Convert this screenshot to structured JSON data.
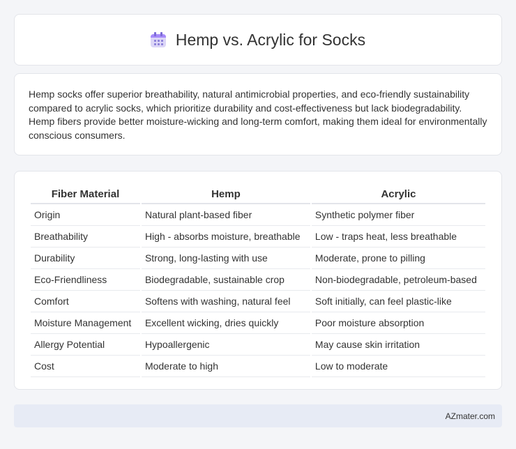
{
  "header": {
    "title": "Hemp vs. Acrylic for Socks",
    "icon": "calendar-icon"
  },
  "summary": "Hemp socks offer superior breathability, natural antimicrobial properties, and eco-friendly sustainability compared to acrylic socks, which prioritize durability and cost-effectiveness but lack biodegradability. Hemp fibers provide better moisture-wicking and long-term comfort, making them ideal for environmentally conscious consumers.",
  "table": {
    "headers": [
      "Fiber Material",
      "Hemp",
      "Acrylic"
    ],
    "rows": [
      [
        "Origin",
        "Natural plant-based fiber",
        "Synthetic polymer fiber"
      ],
      [
        "Breathability",
        "High - absorbs moisture, breathable",
        "Low - traps heat, less breathable"
      ],
      [
        "Durability",
        "Strong, long-lasting with use",
        "Moderate, prone to pilling"
      ],
      [
        "Eco-Friendliness",
        "Biodegradable, sustainable crop",
        "Non-biodegradable, petroleum-based"
      ],
      [
        "Comfort",
        "Softens with washing, natural feel",
        "Soft initially, can feel plastic-like"
      ],
      [
        "Moisture Management",
        "Excellent wicking, dries quickly",
        "Poor moisture absorption"
      ],
      [
        "Allergy Potential",
        "Hypoallergenic",
        "May cause skin irritation"
      ],
      [
        "Cost",
        "Moderate to high",
        "Low to moderate"
      ]
    ]
  },
  "footer": {
    "text": "AZmater.com"
  }
}
